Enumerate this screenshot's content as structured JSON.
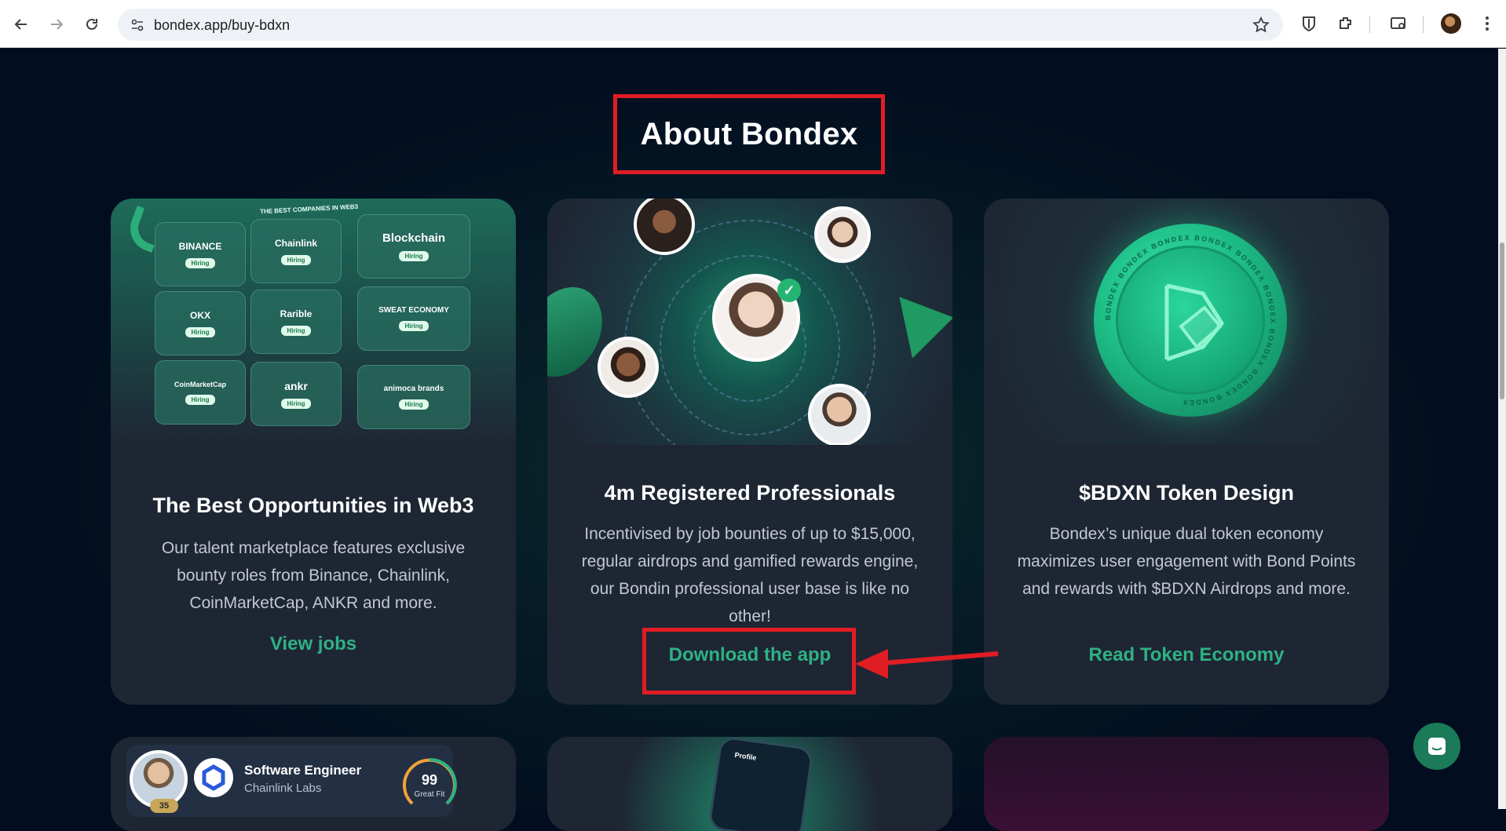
{
  "browser": {
    "url": "bondex.app/buy-bdxn",
    "icons": [
      "back-icon",
      "forward-icon",
      "reload-icon",
      "site-info-icon",
      "star-icon",
      "bitwarden-icon",
      "extensions-icon",
      "cast-icon",
      "profile-avatar",
      "menu-icon"
    ]
  },
  "page": {
    "heading": "About Bondex",
    "cards": [
      {
        "title": "The Best Opportunities in Web3",
        "description": "Our talent marketplace features exclusive bounty roles from Binance, Chainlink, CoinMarketCap, ANKR and more.",
        "link": "View jobs",
        "image_label": "THE BEST COMPANIES IN WEB3",
        "companies": [
          "BINANCE",
          "Chainlink",
          "Blockchain",
          "OKX",
          "Rarible",
          "SWEAT ECONOMY",
          "CoinMarketCap",
          "ankr",
          "animoca brands"
        ],
        "badge": "Hiring"
      },
      {
        "title": "4m Registered Professionals",
        "description": "Incentivised by job bounties of up to $15,000, regular airdrops and gamified rewards engine, our Bondin professional user base is like no other!",
        "link": "Download the app"
      },
      {
        "title": "$BDXN Token Design",
        "description": "Bondex’s unique dual token economy maximizes user engagement with Bond Points and rewards with $BDXN Airdrops and more.",
        "link": "Read Token Economy",
        "coin_text": "BONDEX"
      }
    ],
    "bottom": {
      "job_title": "Software Engineer",
      "company": "Chainlink Labs",
      "score": "99",
      "score_label": "Great Fit",
      "level": "35",
      "phone_label": "Profile"
    }
  },
  "colors": {
    "accent": "#2fb184",
    "background": "#020d1f",
    "card": "#1e2634",
    "annotation": "#e11d24"
  }
}
